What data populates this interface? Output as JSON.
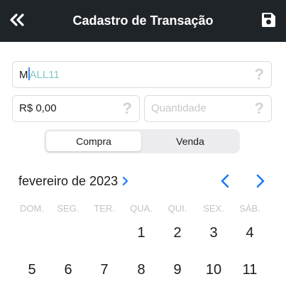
{
  "header": {
    "title": "Cadastro de Transação",
    "back_icon": "double-chevron-left-icon",
    "save_icon": "floppy-disk-icon",
    "background": "#1f2429"
  },
  "form": {
    "ticket": {
      "first_char": "M",
      "rest": "ALL11",
      "help": "?"
    },
    "price": {
      "value": "R$ 0,00",
      "help": "?"
    },
    "quantity": {
      "placeholder": "Quantidade",
      "help": "?"
    }
  },
  "operation": {
    "options": [
      "Compra",
      "Venda"
    ],
    "selected": "Compra"
  },
  "calendar": {
    "month_label": "fevereiro de 2023",
    "accent": "#1e7cf2",
    "weekdays": [
      "DOM.",
      "SEG.",
      "TER.",
      "QUA.",
      "QUI.",
      "SEX.",
      "SÁB."
    ],
    "week1": [
      "1",
      "2",
      "3",
      "4"
    ],
    "week2": [
      "5",
      "6",
      "7",
      "8",
      "9",
      "10",
      "11"
    ]
  }
}
